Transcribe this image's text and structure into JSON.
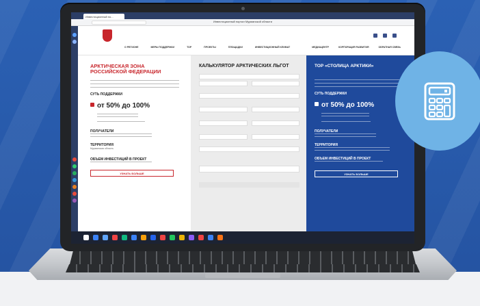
{
  "browser": {
    "tab_title": "Инвестиционный по...",
    "page_title": "Инвестиционный портал Мурманской области"
  },
  "header": {
    "nav_left": [
      "О РЕГИОНЕ",
      "МЕРЫ ПОДДЕРЖКИ",
      "ТОР",
      "ПРОЕКТЫ",
      "ПЛОЩАДКИ",
      "ИНВЕСТИЦИОННЫЙ КЛИМАТ"
    ],
    "nav_right": [
      "МЕДИАЦЕНТР",
      "КОРПОРАЦИЯ РАЗВИТИЯ",
      "ОБРАТНАЯ СВЯЗЬ"
    ]
  },
  "left": {
    "title_line1": "АРКТИЧЕСКАЯ ЗОНА",
    "title_line2": "РОССИЙСКОЙ ФЕДЕРАЦИИ",
    "support_heading": "СУТЬ ПОДДЕРЖКИ",
    "big_offer": "от 50% до 100%",
    "recipients": "ПОЛУЧАТЕЛИ",
    "territory": "ТЕРРИТОРИЯ",
    "territory_value": "Мурманская область",
    "investment_heading": "ОБЪЕМ ИНВЕСТИЦИЙ В ПРОЕКТ",
    "button": "УЗНАТЬ БОЛЬШЕ"
  },
  "middle": {
    "title": "КАЛЬКУЛЯТОР АРКТИЧЕСКИХ ЛЬГОТ"
  },
  "right": {
    "title": "ТОР «СТОЛИЦА АРКТИКИ»",
    "support_heading": "СУТЬ ПОДДЕРЖКИ",
    "big_offer": "от 50% до 100%",
    "recipients": "ПОЛУЧАТЕЛИ",
    "territory": "ТЕРРИТОРИЯ",
    "investment_heading": "ОБЪЕМ ИНВЕСТИЦИЙ В ПРОЕКТ",
    "button": "УЗНАТЬ БОЛЬШЕ"
  },
  "colors": {
    "brand_red": "#c8262c",
    "brand_blue": "#1f4a9c",
    "badge": "#6fb3e6"
  }
}
